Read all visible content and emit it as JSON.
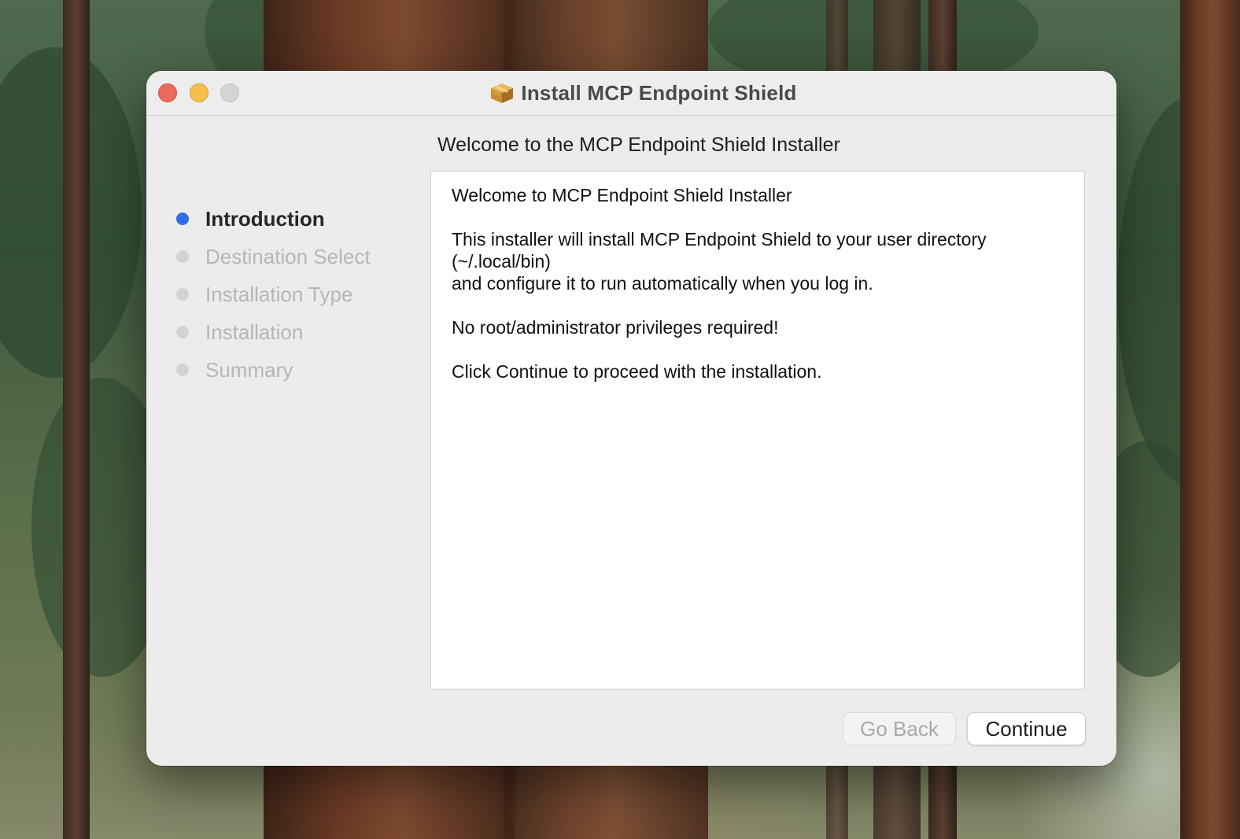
{
  "window": {
    "title": "Install MCP Endpoint Shield",
    "icon": "package-icon"
  },
  "sidebar": {
    "steps": [
      {
        "label": "Introduction",
        "state": "active"
      },
      {
        "label": "Destination Select",
        "state": "inactive"
      },
      {
        "label": "Installation Type",
        "state": "inactive"
      },
      {
        "label": "Installation",
        "state": "inactive"
      },
      {
        "label": "Summary",
        "state": "inactive"
      }
    ]
  },
  "content": {
    "heading": "Welcome to the MCP Endpoint Shield Installer",
    "paragraphs": [
      {
        "lines": [
          "Welcome to MCP Endpoint Shield Installer"
        ]
      },
      {
        "lines": [
          "This installer will install MCP Endpoint Shield to your user directory",
          "(~/.local/bin)",
          "and configure it to run automatically when you log in."
        ]
      },
      {
        "lines": [
          "No root/administrator privileges required!"
        ]
      },
      {
        "lines": [
          "Click Continue to proceed with the installation."
        ]
      }
    ]
  },
  "buttons": {
    "back_label": "Go Back",
    "continue_label": "Continue"
  },
  "colors": {
    "accent": "#2f6ee9",
    "close": "#ed6a5e",
    "minimize": "#f5bf4f",
    "zoom_disabled": "#d4d4d4"
  }
}
